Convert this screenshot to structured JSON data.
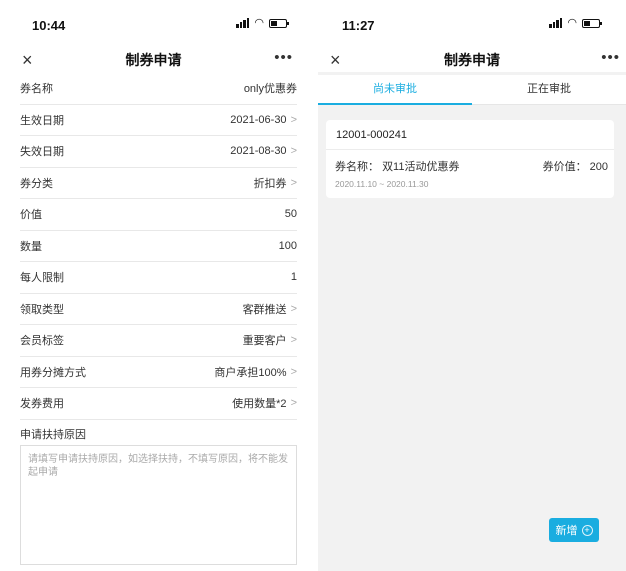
{
  "left": {
    "time": "10:44",
    "nav": {
      "close_icon": "×",
      "title": "制券申请",
      "more_icon": "•••"
    },
    "rows": [
      {
        "label": "券名称",
        "value": "only优惠券",
        "chevron": false
      },
      {
        "label": "生效日期",
        "value": "2021-06-30",
        "chevron": true
      },
      {
        "label": "失效日期",
        "value": "2021-08-30",
        "chevron": true
      },
      {
        "label": "券分类",
        "value": "折扣券",
        "chevron": true
      },
      {
        "label": "价值",
        "value": "50",
        "chevron": false
      },
      {
        "label": "数量",
        "value": "100",
        "chevron": false
      },
      {
        "label": "每人限制",
        "value": "1",
        "chevron": false
      },
      {
        "label": "领取类型",
        "value": "客群推送",
        "chevron": true
      },
      {
        "label": "会员标签",
        "value": "重要客户",
        "chevron": true
      },
      {
        "label": "用券分摊方式",
        "value": "商户承担100%",
        "chevron": true
      },
      {
        "label": "发券费用",
        "value": "使用数量*2",
        "chevron": true
      }
    ],
    "chevron_glyph": ">",
    "reason": {
      "label": "申请扶持原因",
      "placeholder": "请填写申请扶持原因，如选择扶持，不填写原因，将不能发起申请"
    }
  },
  "right": {
    "time": "11:27",
    "nav": {
      "close_icon": "×",
      "title": "制券申请",
      "more_icon": "•••"
    },
    "tabs": [
      {
        "label": "尚未审批",
        "active": true
      },
      {
        "label": "正在审批",
        "active": false
      }
    ],
    "card": {
      "id": "12001-000241",
      "name_label": "券名称：",
      "name": "双11活动优惠券",
      "price_label": "券价值：",
      "price": "200",
      "date_range": "2020.11.10 ~ 2020.11.30"
    },
    "add_button": {
      "label": "新增",
      "icon": "+"
    }
  },
  "colors": {
    "accent": "#1aade0",
    "background": "#f2f2f2",
    "divider": "#e8e8e8"
  }
}
